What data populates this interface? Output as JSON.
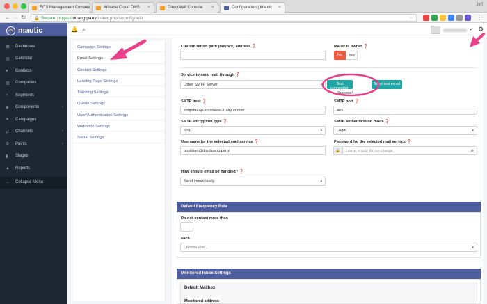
{
  "browser": {
    "tabs": [
      {
        "title": "ECS Management Console",
        "active": false,
        "favicon_color": "#f59b22"
      },
      {
        "title": "Alibaba Cloud DNS",
        "active": false,
        "favicon_color": "#f59b22"
      },
      {
        "title": "DirectMail Console",
        "active": false,
        "favicon_color": "#f59b22"
      },
      {
        "title": "Configuration | Mautic",
        "active": true,
        "favicon_color": "#4e5d9d"
      }
    ],
    "user_corner": "Jeff",
    "url": {
      "secure_label": "Secure",
      "separator": "|",
      "scheme": "https://",
      "host": "duang.party",
      "path": "/index.php/s/config/edit"
    }
  },
  "app": {
    "brand": "mautic",
    "colors": {
      "brand": "#4e5d9d",
      "sidebar": "#1d2731",
      "danger": "#f0593e",
      "teal": "#1fa5a4",
      "annotation": "#e8408b"
    }
  },
  "sidebar": {
    "items": [
      {
        "label": "Dashboard",
        "icon": "dashboard-icon",
        "glyph": "▦"
      },
      {
        "label": "Calendar",
        "icon": "calendar-icon",
        "glyph": "▤"
      },
      {
        "label": "Contacts",
        "icon": "contacts-icon",
        "glyph": "●"
      },
      {
        "label": "Companies",
        "icon": "companies-icon",
        "glyph": "▥"
      },
      {
        "label": "Segments",
        "icon": "segments-icon",
        "glyph": "◔"
      },
      {
        "label": "Components",
        "icon": "components-icon",
        "glyph": "◈",
        "arrow": true
      },
      {
        "label": "Campaigns",
        "icon": "campaigns-icon",
        "glyph": "✦"
      },
      {
        "label": "Channels",
        "icon": "channels-icon",
        "glyph": "⇄",
        "arrow": true
      },
      {
        "label": "Points",
        "icon": "points-icon",
        "glyph": "⚙",
        "arrow": true
      },
      {
        "label": "Stages",
        "icon": "stages-icon",
        "glyph": "▮"
      },
      {
        "label": "Reports",
        "icon": "reports-icon",
        "glyph": "▲"
      }
    ],
    "collapse_label": "Collapse Menu"
  },
  "settings_nav": {
    "items": [
      {
        "label": "Campaign Settings",
        "active": false
      },
      {
        "label": "Email Settings",
        "active": true
      },
      {
        "label": "Contact Settings",
        "active": false
      },
      {
        "label": "Landing Page Settings",
        "active": false
      },
      {
        "label": "Tracking Settings",
        "active": false
      },
      {
        "label": "Queue Settings",
        "active": false
      },
      {
        "label": "User/Authentication Settings",
        "active": false
      },
      {
        "label": "Webhook Settings",
        "active": false
      },
      {
        "label": "Social Settings",
        "active": false
      }
    ]
  },
  "form": {
    "return_path": {
      "label": "Custom return path (bounce) address",
      "value": ""
    },
    "mailer_is_owner": {
      "label": "Mailer is owner",
      "no": "No",
      "yes": "Yes",
      "selected": "No"
    },
    "service": {
      "label": "Service to send mail through",
      "value": "Other SMTP Server"
    },
    "test_connection": "Test connection",
    "send_test_email": "Send test email",
    "success_text": "Success!",
    "smtp_host": {
      "label": "SMTP host",
      "value": "smtpdm-ap-southeast-1.aliyun.com"
    },
    "smtp_port": {
      "label": "SMTP port",
      "value": "465"
    },
    "smtp_encryption": {
      "label": "SMTP encryption type",
      "value": "SSL"
    },
    "smtp_auth_mode": {
      "label": "SMTP authentication mode",
      "value": "Login"
    },
    "username": {
      "label": "Username for the selected mail service",
      "value": "postman@dm.duang.party"
    },
    "password": {
      "label": "Password for the selected mail service",
      "placeholder": "Leave empty for no change"
    },
    "handling": {
      "label": "How should email be handled?",
      "value": "Send immediately"
    }
  },
  "frequency": {
    "title": "Default Frequency Rule",
    "do_not_contact_label": "Do not contact more than",
    "each_label": "each",
    "each_placeholder": "Choose one..."
  },
  "monitored": {
    "title": "Monitored Inbox Settings",
    "default_mailbox": "Default Mailbox",
    "address_label": "Monitored address"
  }
}
